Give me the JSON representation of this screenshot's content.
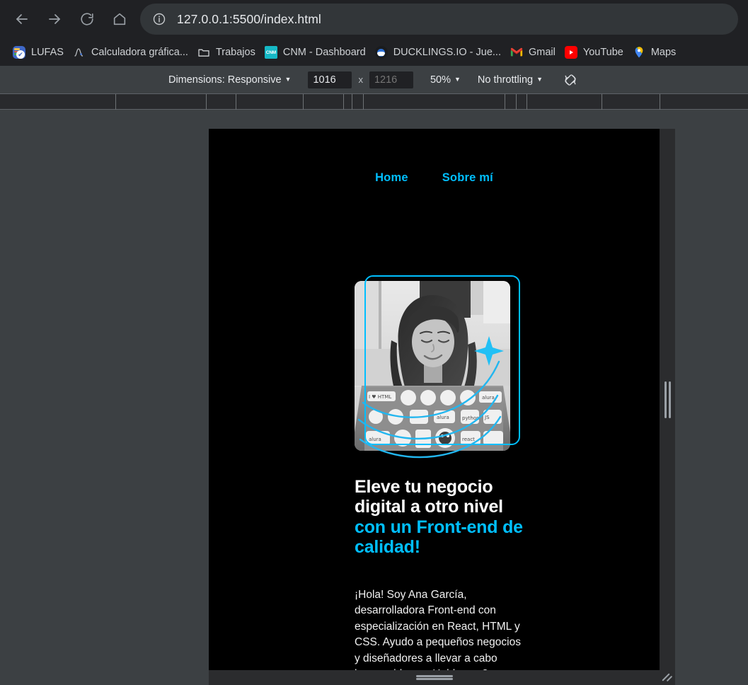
{
  "browser": {
    "nav": {
      "back_icon": "arrow-left-icon",
      "forward_icon": "arrow-right-icon",
      "reload_icon": "reload-icon",
      "home_icon": "home-icon"
    },
    "omnibox": {
      "site_info_icon": "info-circle-icon",
      "url": "127.0.0.1:5500/index.html"
    },
    "bookmarks": [
      {
        "label": "LUFAS",
        "icon": "lufas-icon"
      },
      {
        "label": "Calculadora gráfica...",
        "icon": "desmos-graph-icon"
      },
      {
        "label": "Trabajos",
        "icon": "folder-icon"
      },
      {
        "label": "CNM - Dashboard",
        "icon": "cnm-icon"
      },
      {
        "label": "DUCKLINGS.IO - Jue...",
        "icon": "ducklings-icon"
      },
      {
        "label": "Gmail",
        "icon": "gmail-icon"
      },
      {
        "label": "YouTube",
        "icon": "youtube-icon"
      },
      {
        "label": "Maps",
        "icon": "google-maps-icon"
      }
    ]
  },
  "devtools": {
    "device_toolbar": {
      "dimensions_label": "Dimensions: Responsive",
      "dimensions_caret": "▼",
      "width_value": "1016",
      "height_placeholder": "1216",
      "multiply_symbol": "x",
      "zoom_label": "50%",
      "zoom_caret": "▼",
      "throttling_label": "No throttling",
      "throttling_caret": "▼",
      "rotate_icon": "rotate-device-icon"
    },
    "ruler_ticks": [
      163,
      291,
      333,
      428,
      485,
      497,
      513,
      713,
      729,
      744,
      850,
      932
    ],
    "handles": {
      "right_handle": "resize-handle-right",
      "bottom_handle": "resize-handle-bottom",
      "corner_handle": "resize-handle-corner"
    }
  },
  "page": {
    "nav_links": [
      {
        "label": "Home"
      },
      {
        "label": "Sobre mí"
      }
    ],
    "hero": {
      "photo_alt": "portrait of a smiling woman working on a sticker-covered laptop",
      "decoration_icon": "sparkle-icon",
      "title_main": "Eleve tu negocio digital a otro ",
      "title_accent": "nivel con un Front-end de calidad!",
      "title_plain_part": "Eleve tu negocio digital a otro",
      "title_accent_part": "con un Front-end de calidad!",
      "title_bridge": "nivel ",
      "description": "¡Hola! Soy Ana García, desarrolladora Front-end con especialización en React, HTML y CSS. Ayudo a pequeños negocios y diseñadores a llevar a cabo buenas ideas. ¿Hablamos?"
    }
  },
  "colors": {
    "accent": "#00bfff",
    "page_bg": "#000000",
    "chrome_bg": "#202124",
    "devtools_bg": "#3c4043",
    "ruler_bg": "#292a2d"
  }
}
